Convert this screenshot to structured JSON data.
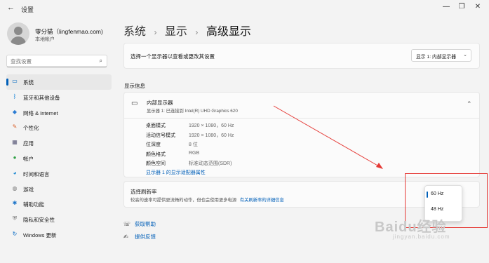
{
  "window": {
    "title": "设置",
    "controls": [
      "—",
      "❐",
      "✕"
    ]
  },
  "profile": {
    "name": "零分猫（lingfenmao.com)",
    "account_type": "本地帐户"
  },
  "search": {
    "placeholder": "查找设置"
  },
  "sidebar": {
    "items": [
      {
        "label": "系统",
        "icon": "monitor-icon",
        "glyph": "▭",
        "color": "#0067c0",
        "active": true
      },
      {
        "label": "蓝牙和其他设备",
        "icon": "bluetooth-icon",
        "glyph": "ᛒ",
        "color": "#0078d4",
        "active": false
      },
      {
        "label": "网络 & Internet",
        "icon": "wifi-icon",
        "glyph": "◆",
        "color": "#2b7cd3",
        "active": false
      },
      {
        "label": "个性化",
        "icon": "brush-icon",
        "glyph": "✎",
        "color": "#d9612b",
        "active": false
      },
      {
        "label": "应用",
        "icon": "apps-icon",
        "glyph": "▦",
        "color": "#5a5a7a",
        "active": false
      },
      {
        "label": "帐户",
        "icon": "account-icon",
        "glyph": "●",
        "color": "#2ea043",
        "active": false
      },
      {
        "label": "时间和语言",
        "icon": "globe-clock-icon",
        "glyph": "◕",
        "color": "#1f8ad2",
        "active": false
      },
      {
        "label": "游戏",
        "icon": "gamepad-icon",
        "glyph": "◍",
        "color": "#777777",
        "active": false
      },
      {
        "label": "辅助功能",
        "icon": "accessibility-icon",
        "glyph": "✱",
        "color": "#1a73c8",
        "active": false
      },
      {
        "label": "隐私和安全性",
        "icon": "shield-icon",
        "glyph": "⛨",
        "color": "#6b6b6b",
        "active": false
      },
      {
        "label": "Windows 更新",
        "icon": "update-icon",
        "glyph": "↻",
        "color": "#0a6cc4",
        "active": false
      }
    ]
  },
  "breadcrumb": {
    "level1": "系统",
    "level2": "显示",
    "current": "高级显示",
    "separator": "›"
  },
  "display_select": {
    "label": "选择一个显示器以查看或更改其设置",
    "value": "显示 1: 内部显示器"
  },
  "display_info": {
    "section_title": "显示信息",
    "display_name": "内部显示器",
    "display_desc": "显示器 1: 已连接到 Intel(R) UHD Graphics 620",
    "rows": [
      {
        "label": "桌面模式",
        "value": "1920 × 1080，60 Hz"
      },
      {
        "label": "活动信号模式",
        "value": "1920 × 1080，60 Hz"
      },
      {
        "label": "位深度",
        "value": "8 位"
      },
      {
        "label": "颜色格式",
        "value": "RGB"
      },
      {
        "label": "颜色空间",
        "value": "标准动态范围(SDR)"
      }
    ],
    "adapter_link": "显示器 1 的显示适配器属性"
  },
  "refresh_rate": {
    "title": "选择刷新率",
    "desc": "较高的速率可提供更流畅的动作，但也会使用更多电源",
    "link": "有关刷新率的详细信息",
    "options": [
      "60 Hz",
      "48 Hz"
    ],
    "selected": "60 Hz"
  },
  "help": {
    "get_help": "获取帮助",
    "feedback": "提供反馈"
  },
  "annotation": {
    "color": "#e53935"
  },
  "watermark": {
    "main": "Baidu经验",
    "sub": "jingyan.baidu.com"
  }
}
